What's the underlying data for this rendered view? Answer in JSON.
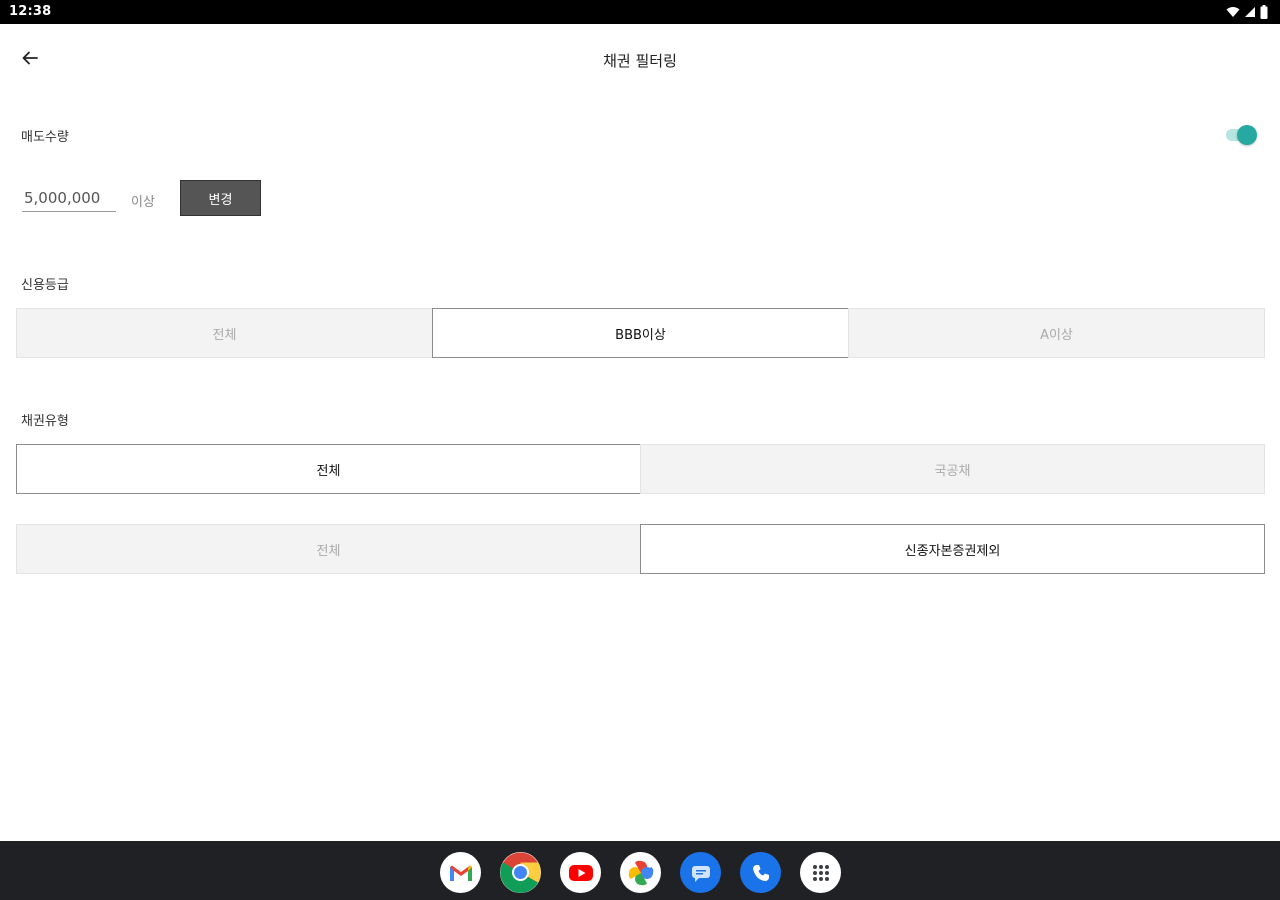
{
  "status_bar": {
    "time": "12:38",
    "icons": [
      "wifi-icon",
      "signal-icon",
      "battery-icon"
    ]
  },
  "app_bar": {
    "title": "채권 필터링",
    "back_icon": "arrow-left-icon"
  },
  "sell_quantity": {
    "label": "매도수량",
    "toggle_on": true,
    "amount": "5,000,000",
    "suffix": "이상",
    "change_button": "변경"
  },
  "credit_rating": {
    "label": "신용등급",
    "options": [
      "전체",
      "BBB이상",
      "A이상"
    ],
    "selected_index": 1
  },
  "bond_type": {
    "label": "채권유형",
    "row1": {
      "options": [
        "전체",
        "국공채"
      ],
      "selected_index": 0
    },
    "row2": {
      "options": [
        "전체",
        "신종자본증권제외"
      ],
      "selected_index": 1
    }
  },
  "dock": {
    "apps": [
      "gmail-icon",
      "chrome-icon",
      "youtube-icon",
      "photos-icon",
      "messages-icon",
      "phone-icon",
      "app-drawer-icon"
    ]
  },
  "colors": {
    "accent": "#26a9a3",
    "accent_track": "#b7e3e1",
    "button": "#555555",
    "nav_bar": "#202124"
  }
}
